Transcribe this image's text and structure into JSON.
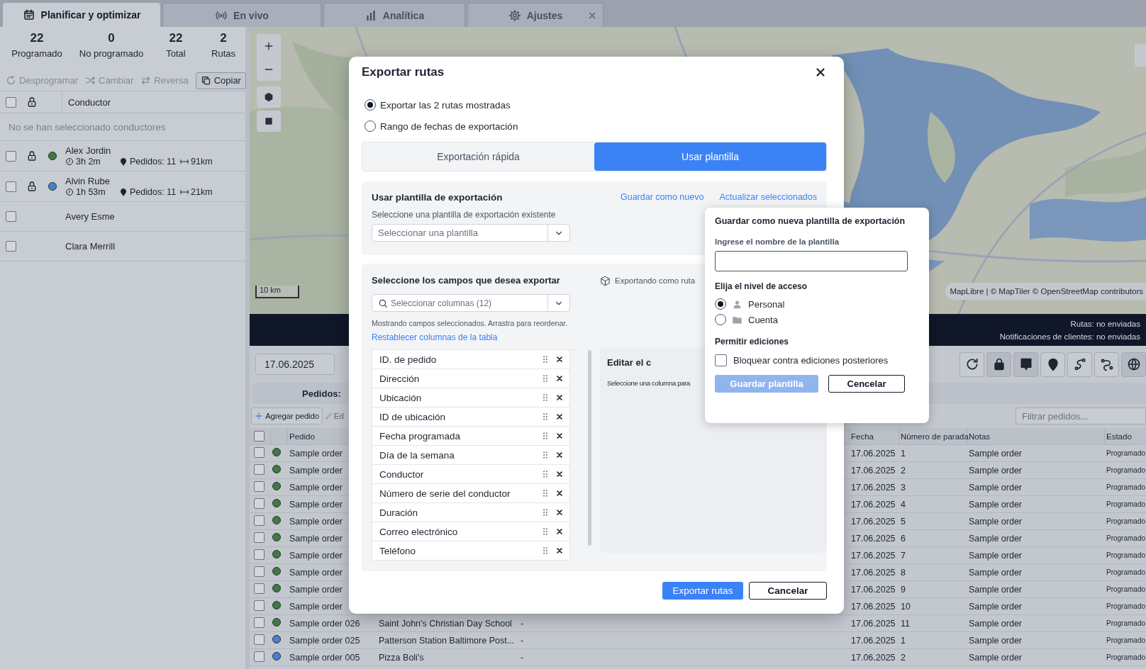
{
  "tabs": [
    {
      "label": "Planificar y optimizar",
      "selected": true,
      "closable": false
    },
    {
      "label": "En vivo",
      "selected": false,
      "closable": false
    },
    {
      "label": "Analítica",
      "selected": false,
      "closable": false
    },
    {
      "label": "Ajustes",
      "selected": false,
      "closable": true
    }
  ],
  "summary": [
    {
      "value": "22",
      "label": "Programado"
    },
    {
      "value": "0",
      "label": "No programado"
    },
    {
      "value": "22",
      "label": "Total"
    },
    {
      "value": "2",
      "label": "Rutas"
    }
  ],
  "actions": [
    {
      "label": "Desprogramar",
      "disabled": true
    },
    {
      "label": "Cambiar",
      "disabled": true
    },
    {
      "label": "Reversa",
      "disabled": true
    },
    {
      "label": "Copiar",
      "disabled": false
    }
  ],
  "drivers": {
    "column": "Conductor",
    "all_checked": false,
    "empty_message": "No se han seleccionado conductores",
    "rows": [
      {
        "name": "Alex Jordin",
        "checked": false,
        "locked": true,
        "color": "#3f7a42",
        "duration": "3h 2m",
        "orders": "Pedidos: 11",
        "distance": "91km"
      },
      {
        "name": "Alvin Rube",
        "checked": false,
        "locked": true,
        "color": "#4a7fd0",
        "duration": "1h 53m",
        "orders": "Pedidos: 11",
        "distance": "21km"
      },
      {
        "name": "Avery Esme",
        "checked": false,
        "locked": false
      },
      {
        "name": "Clara Merrill",
        "checked": false,
        "locked": false
      }
    ]
  },
  "map": {
    "scale": "10 km",
    "attribution": "MapLibre | © MapTiler © OpenStreetMap contributors"
  },
  "status": [
    "Rutas: no enviadas",
    "Notificaciones de clientes: no enviadas"
  ],
  "date": "17.06.2025",
  "orders": {
    "title": "Pedidos:",
    "add_button": "Agregar pedido",
    "edit_button": "Ed",
    "filter_placeholder": "Filtrar pedidos...",
    "all_checked": false,
    "columns": {
      "order": "Pedido",
      "date": "Fecha",
      "stop": "Número de parada",
      "notes": "Notas",
      "status": "Estado"
    },
    "rows": [
      {
        "order": "Sample order",
        "date": "17.06.2025",
        "stop": "1",
        "notes": "Sample order",
        "status": "Programado",
        "color": "#3f7a42",
        "checked": false
      },
      {
        "order": "Sample order",
        "date": "17.06.2025",
        "stop": "2",
        "notes": "Sample order",
        "status": "Programado",
        "color": "#3f7a42",
        "checked": false
      },
      {
        "order": "Sample order",
        "date": "17.06.2025",
        "stop": "3",
        "notes": "Sample order",
        "status": "Programado",
        "color": "#3f7a42",
        "checked": false
      },
      {
        "order": "Sample order",
        "date": "17.06.2025",
        "stop": "4",
        "notes": "Sample order",
        "status": "Programado",
        "color": "#3f7a42",
        "checked": false
      },
      {
        "order": "Sample order",
        "date": "17.06.2025",
        "stop": "5",
        "notes": "Sample order",
        "status": "Programado",
        "color": "#3f7a42",
        "checked": false
      },
      {
        "order": "Sample order",
        "date": "17.06.2025",
        "stop": "6",
        "notes": "Sample order",
        "status": "Programado",
        "color": "#3f7a42",
        "checked": false
      },
      {
        "order": "Sample order",
        "date": "17.06.2025",
        "stop": "7",
        "notes": "Sample order",
        "status": "Programado",
        "color": "#3f7a42",
        "checked": false
      },
      {
        "order": "Sample order",
        "date": "17.06.2025",
        "stop": "8",
        "notes": "Sample order",
        "status": "Programado",
        "color": "#3f7a42",
        "checked": false
      },
      {
        "order": "Sample order",
        "date": "17.06.2025",
        "stop": "9",
        "notes": "Sample order",
        "status": "Programado",
        "color": "#3f7a42",
        "checked": false
      },
      {
        "order": "Sample order",
        "date": "17.06.2025",
        "stop": "10",
        "notes": "Sample order",
        "status": "Programado",
        "color": "#3f7a42",
        "checked": false
      },
      {
        "order": "Sample order 026",
        "address": "Saint John's Christian Day School",
        "column_3": "-",
        "date": "17.06.2025",
        "stop": "11",
        "notes": "Sample order",
        "status": "Programado",
        "color": "#3f7a42",
        "checked": false
      },
      {
        "order": "Sample order 025",
        "address": "Patterson Station Baltimore Post...",
        "column_3": "-",
        "date": "17.06.2025",
        "stop": "1",
        "notes": "Sample order",
        "status": "Programado",
        "color": "#4a7fd0",
        "checked": false
      },
      {
        "order": "Sample order 005",
        "address": "Pizza Boli's",
        "column_3": "-",
        "date": "17.06.2025",
        "stop": "2",
        "notes": "Sample order",
        "status": "Programado",
        "color": "#4a7fd0",
        "checked": false
      }
    ]
  },
  "export_dialog": {
    "title": "Exportar rutas",
    "scope_options": [
      {
        "label": "Exportar las 2 rutas mostradas",
        "selected": true
      },
      {
        "label": "Rango de fechas de exportación",
        "selected": false
      }
    ],
    "modes": [
      {
        "label": "Exportación rápida",
        "selected": false
      },
      {
        "label": "Usar plantilla",
        "selected": true
      }
    ],
    "template": {
      "title": "Usar plantilla de exportación",
      "links": [
        "Guardar como nuevo",
        "Actualizar seleccionados"
      ],
      "select_label": "Seleccione una plantilla de exportación existente",
      "select_placeholder": "Seleccionar una plantilla"
    },
    "fields": {
      "title": "Seleccione los campos que desea exportar",
      "export_note": "Exportando como ruta",
      "column_select_placeholder": "Seleccionar columnas (12)",
      "hint": "Mostrando campos seleccionados. Arrastra para reordenar.",
      "reset_link": "Restablecer columnas de la tabla",
      "items": [
        "ID. de pedido",
        "Dirección",
        "Ubicación",
        "ID de ubicación",
        "Fecha programada",
        "Día de la semana",
        "Conductor",
        "Número de serie del conductor",
        "Duración",
        "Correo electrónico",
        "Teléfono"
      ]
    },
    "editor": {
      "title": "Editar el c",
      "hint": "Seleccione una columna para"
    },
    "buttons": [
      {
        "label": "Exportar rutas",
        "kind": "primary"
      },
      {
        "label": "Cancelar",
        "kind": "secondary"
      }
    ]
  },
  "save_template_popover": {
    "title": "Guardar como nueva plantilla de exportación",
    "name_label": "Ingrese el nombre de la plantilla",
    "access_title": "Elija el nivel de acceso",
    "access_options": [
      {
        "label": "Personal",
        "selected": true
      },
      {
        "label": "Cuenta",
        "selected": false
      }
    ],
    "edits_title": "Permitir ediciones",
    "lock_option": {
      "label": "Bloquear contra ediciones posteriores",
      "checked": false
    },
    "buttons": [
      {
        "label": "Guardar plantilla",
        "kind": "primary",
        "disabled": true
      },
      {
        "label": "Cencelar",
        "kind": "secondary",
        "disabled": false
      }
    ]
  }
}
